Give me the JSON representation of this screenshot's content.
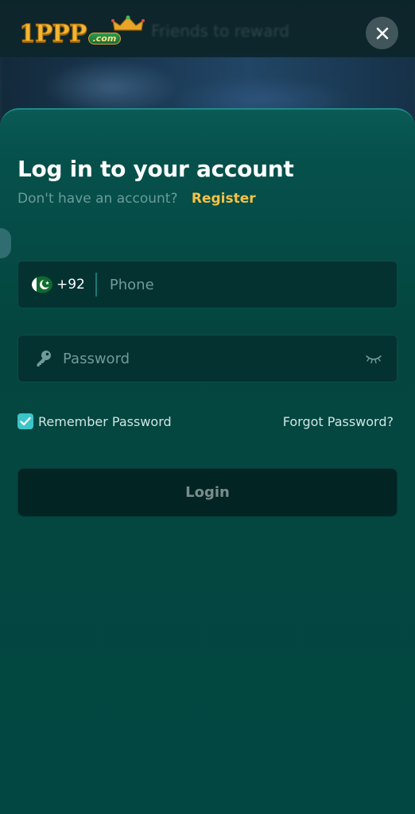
{
  "header": {
    "logo_text": "1PPP",
    "logo_suffix": ".com",
    "background_text": "Friends to reward",
    "close_icon": "close-icon"
  },
  "login": {
    "title": "Log in to your account",
    "no_account_text": "Don't have an account?",
    "register_label": "Register",
    "phone": {
      "flag_icon": "pakistan-flag-icon",
      "country_code": "+92",
      "placeholder": "Phone",
      "value": ""
    },
    "password": {
      "icon": "key-icon",
      "placeholder": "Password",
      "value": "",
      "toggle_icon": "eye-closed-icon"
    },
    "remember_label": "Remember Password",
    "remember_checked": true,
    "forgot_label": "Forgot Password?",
    "submit_label": "Login"
  },
  "colors": {
    "sheet_bg": "#03423f",
    "accent_yellow": "#f5c242",
    "checkbox_teal": "#3cc5c8",
    "field_bg": "#043231",
    "button_bg": "#022423"
  }
}
